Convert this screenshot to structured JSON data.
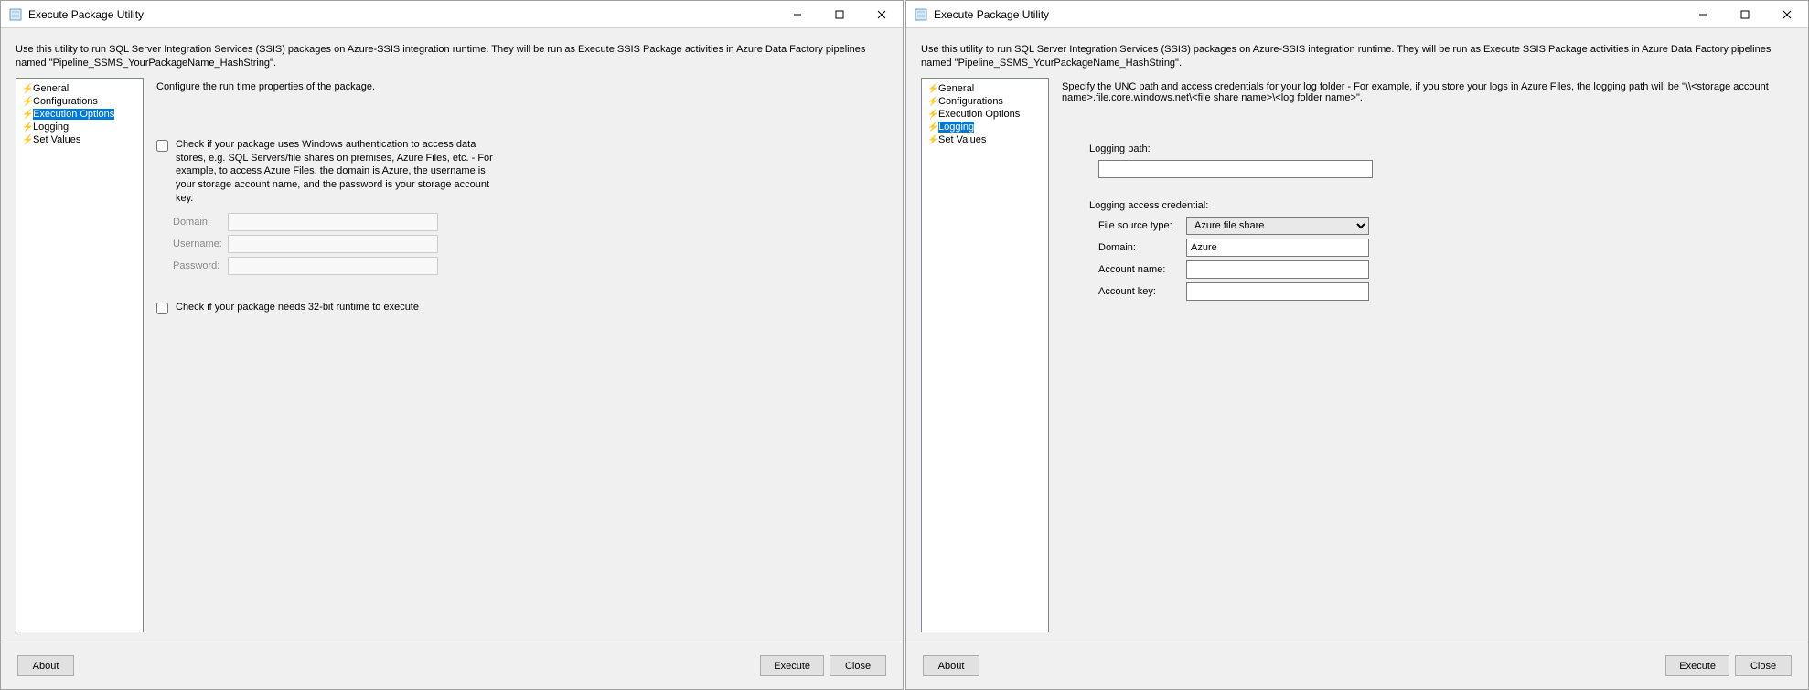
{
  "title": "Execute Package Utility",
  "description": "Use this utility to run SQL Server Integration Services (SSIS) packages on Azure-SSIS integration runtime. They will be run as Execute SSIS Package activities in Azure Data Factory pipelines named \"Pipeline_SSMS_YourPackageName_HashString\".",
  "nav": {
    "general": "General",
    "configurations": "Configurations",
    "execution_options": "Execution Options",
    "logging": "Logging",
    "set_values": "Set Values"
  },
  "exec": {
    "heading": "Configure the run time properties of the package.",
    "auth_text": "Check if your package uses Windows authentication to access data stores, e.g. SQL Servers/file shares on premises, Azure Files, etc. - For example, to access Azure Files, the domain is Azure, the username is your storage account name, and the password is your storage account key.",
    "domain_label": "Domain:",
    "username_label": "Username:",
    "password_label": "Password:",
    "bit32_text": "Check if your package needs 32-bit runtime to execute",
    "domain_value": "",
    "username_value": "",
    "password_value": ""
  },
  "logging": {
    "heading": "Specify the UNC path and access credentials for your log folder - For example, if you store your logs in Azure Files, the logging path will be \"\\\\<storage account name>.file.core.windows.net\\<file share name>\\<log folder name>\".",
    "path_label": "Logging path:",
    "path_value": "",
    "cred_label": "Logging access credential:",
    "file_source_label": "File source type:",
    "file_source_value": "Azure file share",
    "domain_label": "Domain:",
    "domain_value": "Azure",
    "account_name_label": "Account name:",
    "account_name_value": "",
    "account_key_label": "Account key:",
    "account_key_value": ""
  },
  "buttons": {
    "about": "About",
    "execute": "Execute",
    "close": "Close"
  }
}
